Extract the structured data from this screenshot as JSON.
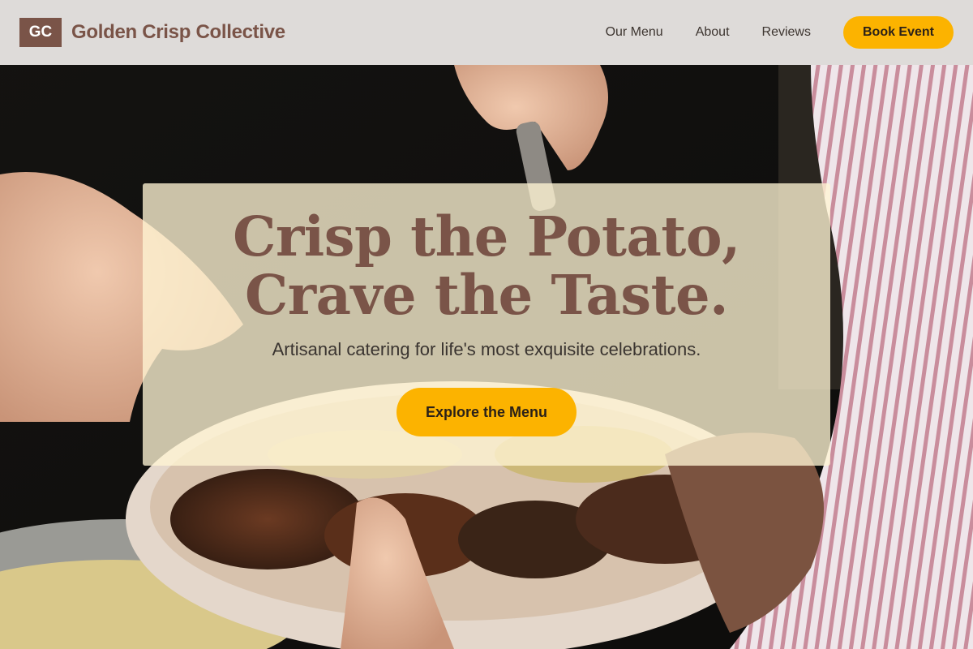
{
  "header": {
    "logo_initials": "GC",
    "brand_name": "Golden Crisp Collective",
    "nav": [
      {
        "label": "Our Menu"
      },
      {
        "label": "About"
      },
      {
        "label": "Reviews"
      }
    ],
    "cta_label": "Book Event"
  },
  "hero": {
    "title": "Crisp the Potato, Crave the Taste.",
    "subtitle": "Artisanal catering for life's most exquisite celebrations.",
    "cta_label": "Explore the Menu"
  },
  "colors": {
    "brand": "#7a5448",
    "accent": "#fcb300",
    "header_bg": "#eeebe8",
    "hero_card_bg": "#fff5d4"
  },
  "background_photo": "hands serving a plate of grilled meats and vegetables"
}
